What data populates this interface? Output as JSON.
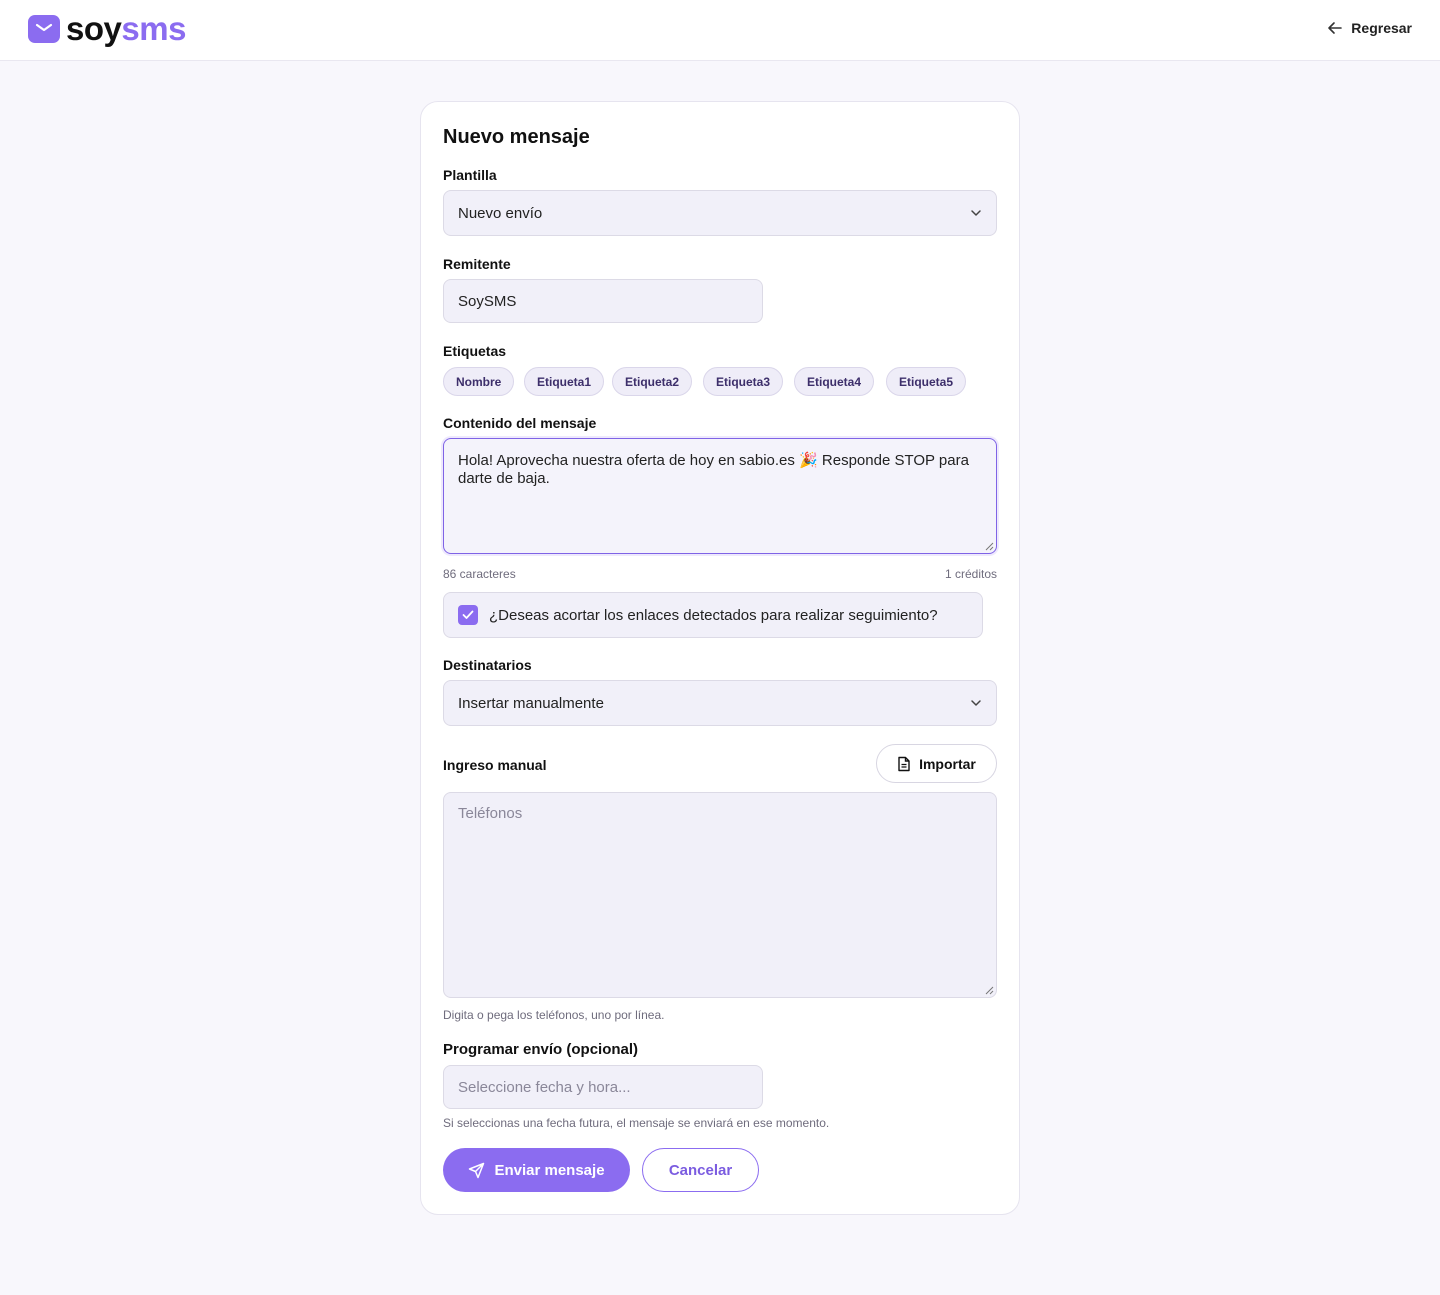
{
  "brand": {
    "part1": "soy",
    "part2": "sms"
  },
  "header": {
    "back_label": "Regresar"
  },
  "form": {
    "title": "Nuevo mensaje",
    "template": {
      "label": "Plantilla",
      "value": "Nuevo envío"
    },
    "sender": {
      "label": "Remitente",
      "value": "SoySMS"
    },
    "tags": {
      "label": "Etiquetas",
      "items": [
        "Nombre",
        "Etiqueta1",
        "Etiqueta2",
        "Etiqueta3",
        "Etiqueta4",
        "Etiqueta5"
      ]
    },
    "message": {
      "label": "Contenido del mensaje",
      "value": "Hola! Aprovecha nuestra oferta de hoy en sabio.es 🎉 Responde STOP para darte de baja.",
      "char_count": "86 caracteres",
      "credits": "1 créditos"
    },
    "shorten_links": {
      "label": "¿Deseas acortar los enlaces detectados para realizar seguimiento?",
      "checked": true
    },
    "recipients": {
      "label": "Destinatarios",
      "value": "Insertar manualmente"
    },
    "manual": {
      "label": "Ingreso manual",
      "import_label": "Importar",
      "placeholder": "Teléfonos",
      "help": "Digita o pega los teléfonos, uno por línea."
    },
    "schedule": {
      "label": "Programar envío (opcional)",
      "placeholder": "Seleccione fecha y hora...",
      "help": "Si seleccionas una fecha futura, el mensaje se enviará en ese momento."
    },
    "actions": {
      "send_label": "Enviar mensaje",
      "cancel_label": "Cancelar"
    }
  },
  "colors": {
    "accent": "#8b6cf0",
    "background": "#f8f7fc",
    "field": "#f1f0f9"
  },
  "icons": [
    "mail-icon",
    "arrow-left-icon",
    "chevron-down-icon",
    "check-icon",
    "file-icon",
    "send-icon"
  ]
}
